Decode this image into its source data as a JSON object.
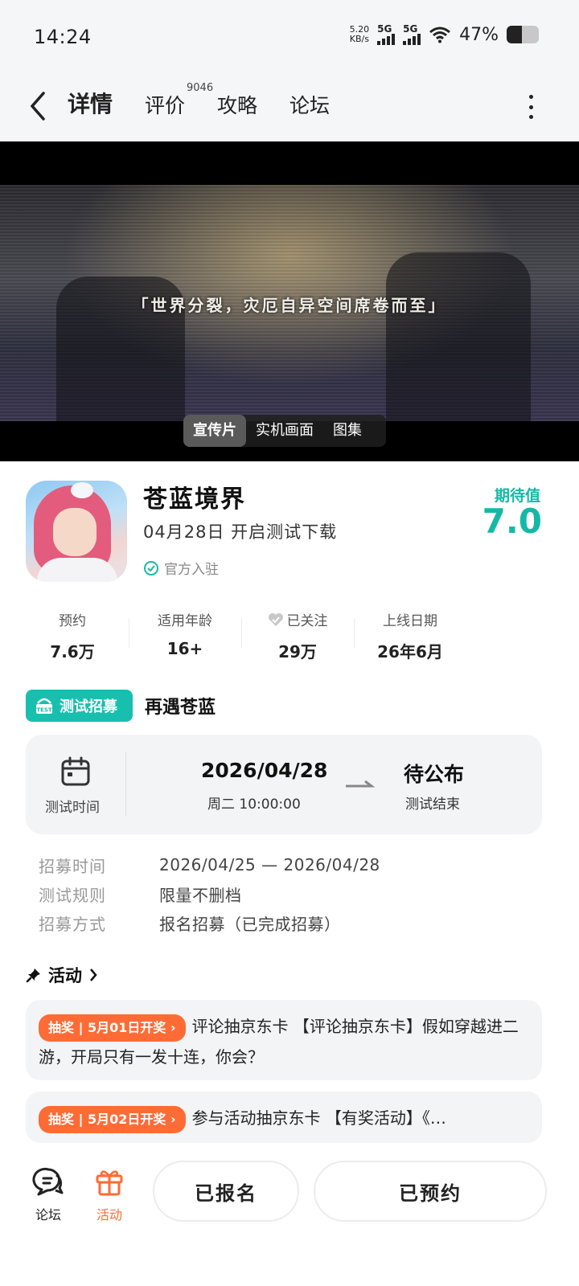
{
  "status": {
    "time": "14:24",
    "net_speed_top": "5.20",
    "net_speed_bottom": "KB/s",
    "sim1": "5G",
    "sim2": "5G",
    "battery_pct": "47%",
    "battery_level": 0.47
  },
  "header": {
    "tabs": [
      {
        "label": "详情"
      },
      {
        "label": "评价"
      },
      {
        "label": "攻略"
      },
      {
        "label": "论坛"
      }
    ],
    "review_count": "9046"
  },
  "media": {
    "caption": "「世界分裂，灾厄自异空间席卷而至」",
    "tabs": [
      "宣传片",
      "实机画面",
      "图集"
    ]
  },
  "game": {
    "title": "苍蓝境界",
    "subtitle": "04月28日 开启测试下载",
    "official": "官方入驻",
    "expect_label": "期待值",
    "expect_value": "7.0"
  },
  "stats": [
    {
      "label": "预约",
      "value": "7.6万"
    },
    {
      "label": "适用年龄",
      "value": "16+"
    },
    {
      "label": "已关注",
      "value": "29万"
    },
    {
      "label": "上线日期",
      "value": "26年6月"
    }
  ],
  "recruit": {
    "badge": "测试招募",
    "title": "再遇苍蓝",
    "test_label": "测试时间",
    "start_date": "2026/04/28",
    "start_time": "周二  10:00:00",
    "end_status": "待公布",
    "end_label": "测试结束",
    "rows": [
      {
        "key": "招募时间",
        "value": "2026/04/25 — 2026/04/28"
      },
      {
        "key": "测试规则",
        "value": "限量不删档"
      },
      {
        "key": "招募方式",
        "value": "报名招募（已完成招募）"
      }
    ]
  },
  "activity": {
    "title": "活动",
    "items": [
      {
        "tag": "抽奖 | 5月01日开奖 ›",
        "text": "评论抽京东卡 【评论抽京东卡】假如穿越进二游，开局只有一发十连，你会？"
      },
      {
        "tag": "抽奖 | 5月02日开奖 ›",
        "text": "参与活动抽京东卡 【有奖活动】《…"
      }
    ]
  },
  "bottom": {
    "forum": "论坛",
    "activity": "活动",
    "signed": "已报名",
    "reserved": "已预约"
  },
  "colors": {
    "accent": "#14b9a6",
    "orange": "#ff6b35"
  }
}
